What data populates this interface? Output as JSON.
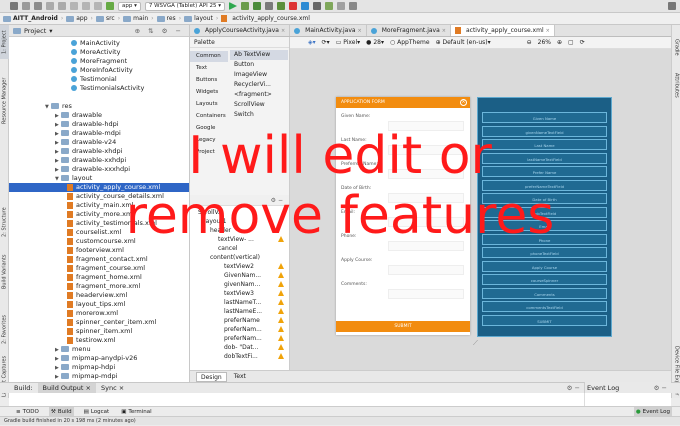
{
  "toolbar": {
    "app_select": "app",
    "device_select": "7  WSVGA (Tablet) API 25"
  },
  "breadcrumb": [
    "AITT_Android",
    "app",
    "src",
    "main",
    "res",
    "layout",
    "activity_apply_course.xml"
  ],
  "project": {
    "title": "Project",
    "items": [
      {
        "label": "MainActivity",
        "type": "act",
        "indent": 62
      },
      {
        "label": "MoreActivity",
        "type": "act",
        "indent": 62
      },
      {
        "label": "MoreFragment",
        "type": "act",
        "indent": 62
      },
      {
        "label": "MoreInfoActivity",
        "type": "act",
        "indent": 62
      },
      {
        "label": "Testimonial",
        "type": "act",
        "indent": 62
      },
      {
        "label": "TestimonialsActivity",
        "type": "act",
        "indent": 62
      },
      {
        "label": "",
        "type": "blank",
        "indent": 0
      },
      {
        "label": "res",
        "type": "fold-open",
        "indent": 36
      },
      {
        "label": "drawable",
        "type": "fold",
        "indent": 46
      },
      {
        "label": "drawable-hdpi",
        "type": "fold",
        "indent": 46
      },
      {
        "label": "drawable-mdpi",
        "type": "fold",
        "indent": 46
      },
      {
        "label": "drawable-v24",
        "type": "fold",
        "indent": 46
      },
      {
        "label": "drawable-xhdpi",
        "type": "fold",
        "indent": 46
      },
      {
        "label": "drawable-xxhdpi",
        "type": "fold",
        "indent": 46
      },
      {
        "label": "drawable-xxxhdpi",
        "type": "fold",
        "indent": 46
      },
      {
        "label": "layout",
        "type": "fold-open",
        "indent": 46
      },
      {
        "label": "activity_apply_course.xml",
        "type": "xml",
        "indent": 58,
        "selected": true
      },
      {
        "label": "activity_course_details.xml",
        "type": "xml",
        "indent": 58
      },
      {
        "label": "activity_main.xml",
        "type": "xml",
        "indent": 58
      },
      {
        "label": "activity_more.xml",
        "type": "xml",
        "indent": 58
      },
      {
        "label": "activity_testimonials.xml",
        "type": "xml",
        "indent": 58
      },
      {
        "label": "courselist.xml",
        "type": "xml",
        "indent": 58
      },
      {
        "label": "customcourse.xml",
        "type": "xml",
        "indent": 58
      },
      {
        "label": "footerview.xml",
        "type": "xml",
        "indent": 58
      },
      {
        "label": "fragment_contact.xml",
        "type": "xml",
        "indent": 58
      },
      {
        "label": "fragment_course.xml",
        "type": "xml",
        "indent": 58
      },
      {
        "label": "fragment_home.xml",
        "type": "xml",
        "indent": 58
      },
      {
        "label": "fragment_more.xml",
        "type": "xml",
        "indent": 58
      },
      {
        "label": "headerview.xml",
        "type": "xml",
        "indent": 58
      },
      {
        "label": "layout_tips.xml",
        "type": "xml",
        "indent": 58
      },
      {
        "label": "morerow.xml",
        "type": "xml",
        "indent": 58
      },
      {
        "label": "spinner_center_item.xml",
        "type": "xml",
        "indent": 58
      },
      {
        "label": "spinner_item.xml",
        "type": "xml",
        "indent": 58
      },
      {
        "label": "testirow.xml",
        "type": "xml",
        "indent": 58
      },
      {
        "label": "menu",
        "type": "fold",
        "indent": 46
      },
      {
        "label": "mipmap-anydpi-v26",
        "type": "fold",
        "indent": 46
      },
      {
        "label": "mipmap-hdpi",
        "type": "fold",
        "indent": 46
      },
      {
        "label": "mipmap-mdpi",
        "type": "fold",
        "indent": 46
      },
      {
        "label": "mipmap-xhdpi",
        "type": "fold",
        "indent": 46
      },
      {
        "label": "mipmap-xxhdpi",
        "type": "fold",
        "indent": 46
      }
    ]
  },
  "editor_tabs": [
    {
      "label": "ApplyCourseActivity.java",
      "active": false
    },
    {
      "label": "MainActivity.java",
      "active": false
    },
    {
      "label": "MoreFragment.java",
      "active": false
    },
    {
      "label": "activity_apply_course.xml",
      "active": true
    }
  ],
  "palette": {
    "title": "Palette",
    "categories": [
      "Common",
      "Text",
      "Buttons",
      "Widgets",
      "Layouts",
      "Containers",
      "Google",
      "Legacy",
      "Project"
    ],
    "items": [
      "Ab TextView",
      "Button",
      "ImageView",
      "RecyclerVi...",
      "<fragment>",
      "ScrollView",
      "Switch"
    ]
  },
  "component_tree": {
    "rows": [
      {
        "label": "ScrollV...",
        "indent": 4
      },
      {
        "label": "layout1",
        "indent": 10
      },
      {
        "label": "header",
        "indent": 16
      },
      {
        "label": "textView- ...",
        "indent": 24,
        "warn": true
      },
      {
        "label": "cancel",
        "indent": 24
      },
      {
        "label": "content(vertical)",
        "indent": 16
      },
      {
        "label": "textView2",
        "indent": 30,
        "warn": true
      },
      {
        "label": "GivenNam...",
        "indent": 30,
        "warn": true
      },
      {
        "label": "givenNam...",
        "indent": 30,
        "warn": true
      },
      {
        "label": "textView3",
        "indent": 30,
        "warn": true
      },
      {
        "label": "lastNameT...",
        "indent": 30,
        "warn": true
      },
      {
        "label": "lastNameE...",
        "indent": 30,
        "warn": true
      },
      {
        "label": "preferName",
        "indent": 30,
        "warn": true
      },
      {
        "label": "preferNam...",
        "indent": 30,
        "warn": true
      },
      {
        "label": "preferNam...",
        "indent": 30,
        "warn": true
      },
      {
        "label": "dob- \"Dat...",
        "indent": 30,
        "warn": true
      },
      {
        "label": "dobTextFi...",
        "indent": 30,
        "warn": true
      }
    ]
  },
  "design_toolbar": {
    "device": "Pixel",
    "api": "28",
    "theme": "AppTheme",
    "locale": "Default (en-us)",
    "zoom": "26%"
  },
  "phone": {
    "header": "APPLICATION FORM",
    "fields": [
      "Given Name:",
      "Last Name:",
      "Preferred Name:",
      "Date of Birth:",
      "Email:",
      "Phone:",
      "Apply Course:",
      "Comments:"
    ],
    "submit": "SUBMIT"
  },
  "blueprint": {
    "rows": [
      "Given Name",
      "givenNameTextField",
      "Last Name",
      "lastNameTextField",
      "Prefer Name",
      "preferNameTextField",
      "Date of Birth",
      "dobTextField",
      "Email",
      "Phone",
      "phoneTextField",
      "Apply Course",
      "courseSpinner",
      "Comments",
      "commentsTextField",
      "SUBMIT"
    ]
  },
  "overlay": {
    "line1": "I will edit or",
    "line2": "remove features"
  },
  "design_tabs": [
    "Design",
    "Text"
  ],
  "build_bar": {
    "build": "Build:",
    "output": "Build Output",
    "sync": "Sync",
    "event_log": "Event Log"
  },
  "bottom_tabs": [
    "TODO",
    "Build",
    "Logcat",
    "Terminal"
  ],
  "bottom_event_log": "Event Log",
  "status": "Gradle build finished in 20 s 198 ms (2 minutes ago)",
  "side_tabs_left": [
    "1: Project",
    "Resource Manager",
    "2: Structure",
    "Build Variants",
    "2: Favorites",
    "Layout Captures"
  ],
  "side_tabs_right": [
    "Gradle",
    "Attributes",
    "Device File Explorer"
  ]
}
